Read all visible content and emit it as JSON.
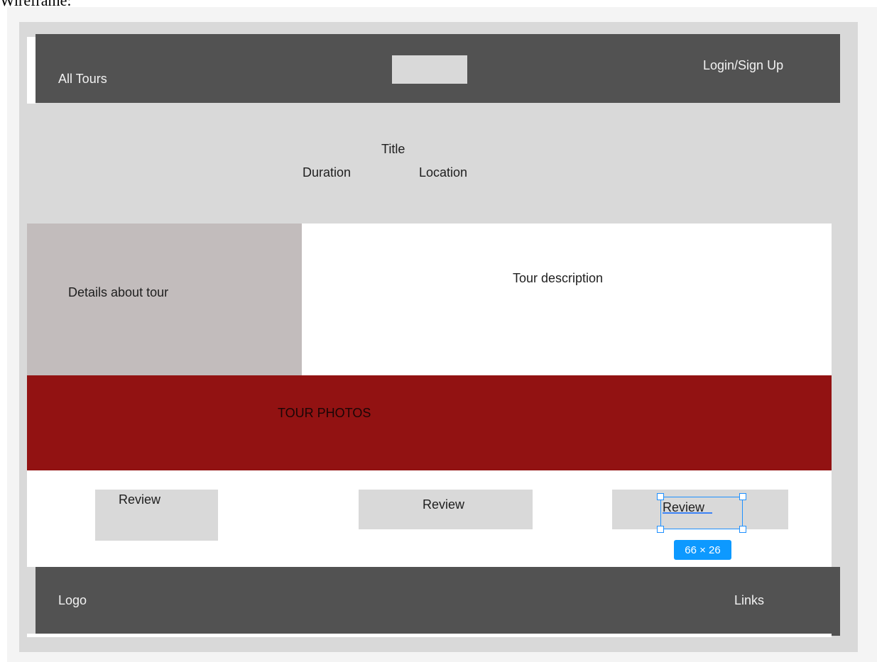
{
  "page": {
    "label": "Wireframe:"
  },
  "header": {
    "left_link": "All Tours",
    "right_link": "Login/Sign Up"
  },
  "hero": {
    "title": "Title",
    "duration": "Duration",
    "location": "Location"
  },
  "details": {
    "label": "Details about tour"
  },
  "description": {
    "label": "Tour description"
  },
  "photos": {
    "label": "TOUR PHOTOS"
  },
  "reviews": {
    "items": [
      {
        "label": "Review"
      },
      {
        "label": "Review"
      },
      {
        "label": "Review"
      }
    ]
  },
  "footer": {
    "logo": "Logo",
    "links": "Links"
  },
  "selection": {
    "size_label": "66 × 26"
  },
  "colors": {
    "header_bg": "#525252",
    "frame_bg": "#d9d9d9",
    "details_bg": "#c2bcbc",
    "photos_bg": "#921212",
    "selection_accent": "#0d99ff"
  }
}
